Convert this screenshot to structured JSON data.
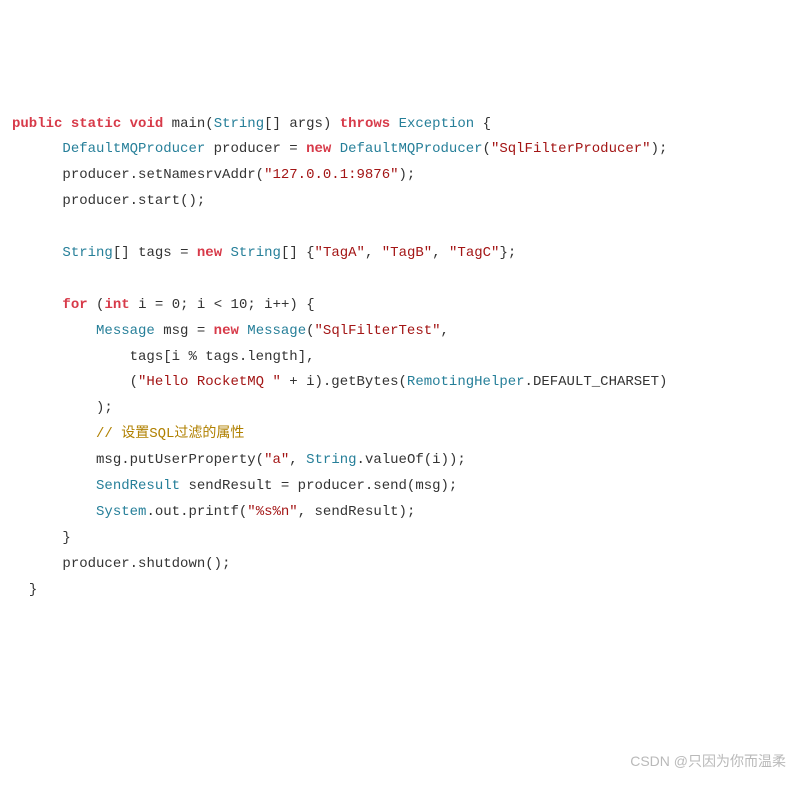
{
  "code": {
    "kw_public": "public",
    "kw_static": "static",
    "kw_void": "void",
    "id_main": "main",
    "type_String": "String",
    "id_args": "args",
    "kw_throws": "throws",
    "type_Exception": "Exception",
    "brace_open": "{",
    "brace_close": "}",
    "type_DefaultMQProducer": "DefaultMQProducer",
    "id_producer": "producer",
    "op_assign": "=",
    "kw_new": "new",
    "str_SqlFilterProducer": "\"SqlFilterProducer\"",
    "id_setNamesrvAddr": "setNamesrvAddr",
    "str_addr": "\"127.0.0.1:9876\"",
    "id_start": "start",
    "id_tags": "tags",
    "str_TagA": "\"TagA\"",
    "str_TagB": "\"TagB\"",
    "str_TagC": "\"TagC\"",
    "kw_for": "for",
    "kw_int": "int",
    "id_i": "i",
    "num_0": "0",
    "num_10": "10",
    "op_lt": "<",
    "op_inc": "++",
    "type_Message": "Message",
    "id_msg": "msg",
    "str_SqlFilterTest": "\"SqlFilterTest\"",
    "id_length": "length",
    "op_mod": "%",
    "str_HelloRocketMQ": "\"Hello RocketMQ \"",
    "op_plus": "+",
    "id_getBytes": "getBytes",
    "type_RemotingHelper": "RemotingHelper",
    "id_DEFAULT_CHARSET": "DEFAULT_CHARSET",
    "comment_sql": "// 设置SQL过滤的属性",
    "id_putUserProperty": "putUserProperty",
    "str_a": "\"a\"",
    "id_valueOf": "valueOf",
    "type_SendResult": "SendResult",
    "id_sendResult": "sendResult",
    "id_send": "send",
    "type_System": "System",
    "id_out": "out",
    "id_printf": "printf",
    "str_fmt": "\"%s%n\"",
    "id_shutdown": "shutdown"
  },
  "watermark": "CSDN @只因为你而温柔"
}
